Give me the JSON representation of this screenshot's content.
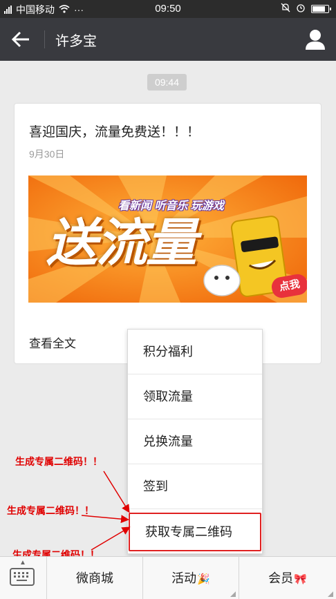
{
  "status_bar": {
    "carrier": "中国移动",
    "more": "···",
    "time": "09:50"
  },
  "header": {
    "title": "许多宝"
  },
  "chat": {
    "timestamp": "09:44",
    "card": {
      "title": "喜迎国庆，流量免费送！！！",
      "date": "9月30日",
      "banner": {
        "headline": "看新闻 听音乐 玩游戏",
        "big_text": "送流量",
        "badge": "点我"
      },
      "read_more": "查看全文"
    }
  },
  "menu": {
    "items": [
      {
        "label": "积分福利"
      },
      {
        "label": "领取流量"
      },
      {
        "label": "兑换流量"
      },
      {
        "label": "签到"
      },
      {
        "label": "获取专属二维码"
      }
    ]
  },
  "annotations": [
    "生成专属二维码！！",
    "生成专属二维码！！",
    "生成专属二维码！！"
  ],
  "bottom_bar": {
    "tabs": [
      {
        "label": "微商城",
        "icon": ""
      },
      {
        "label": "活动",
        "icon": "🎉"
      },
      {
        "label": "会员",
        "icon": "🎀"
      }
    ]
  },
  "colors": {
    "titlebar": "#393a3f",
    "statusbar": "#2c2c2c",
    "annotation": "#e00000",
    "banner_orange": "#f47a12"
  }
}
